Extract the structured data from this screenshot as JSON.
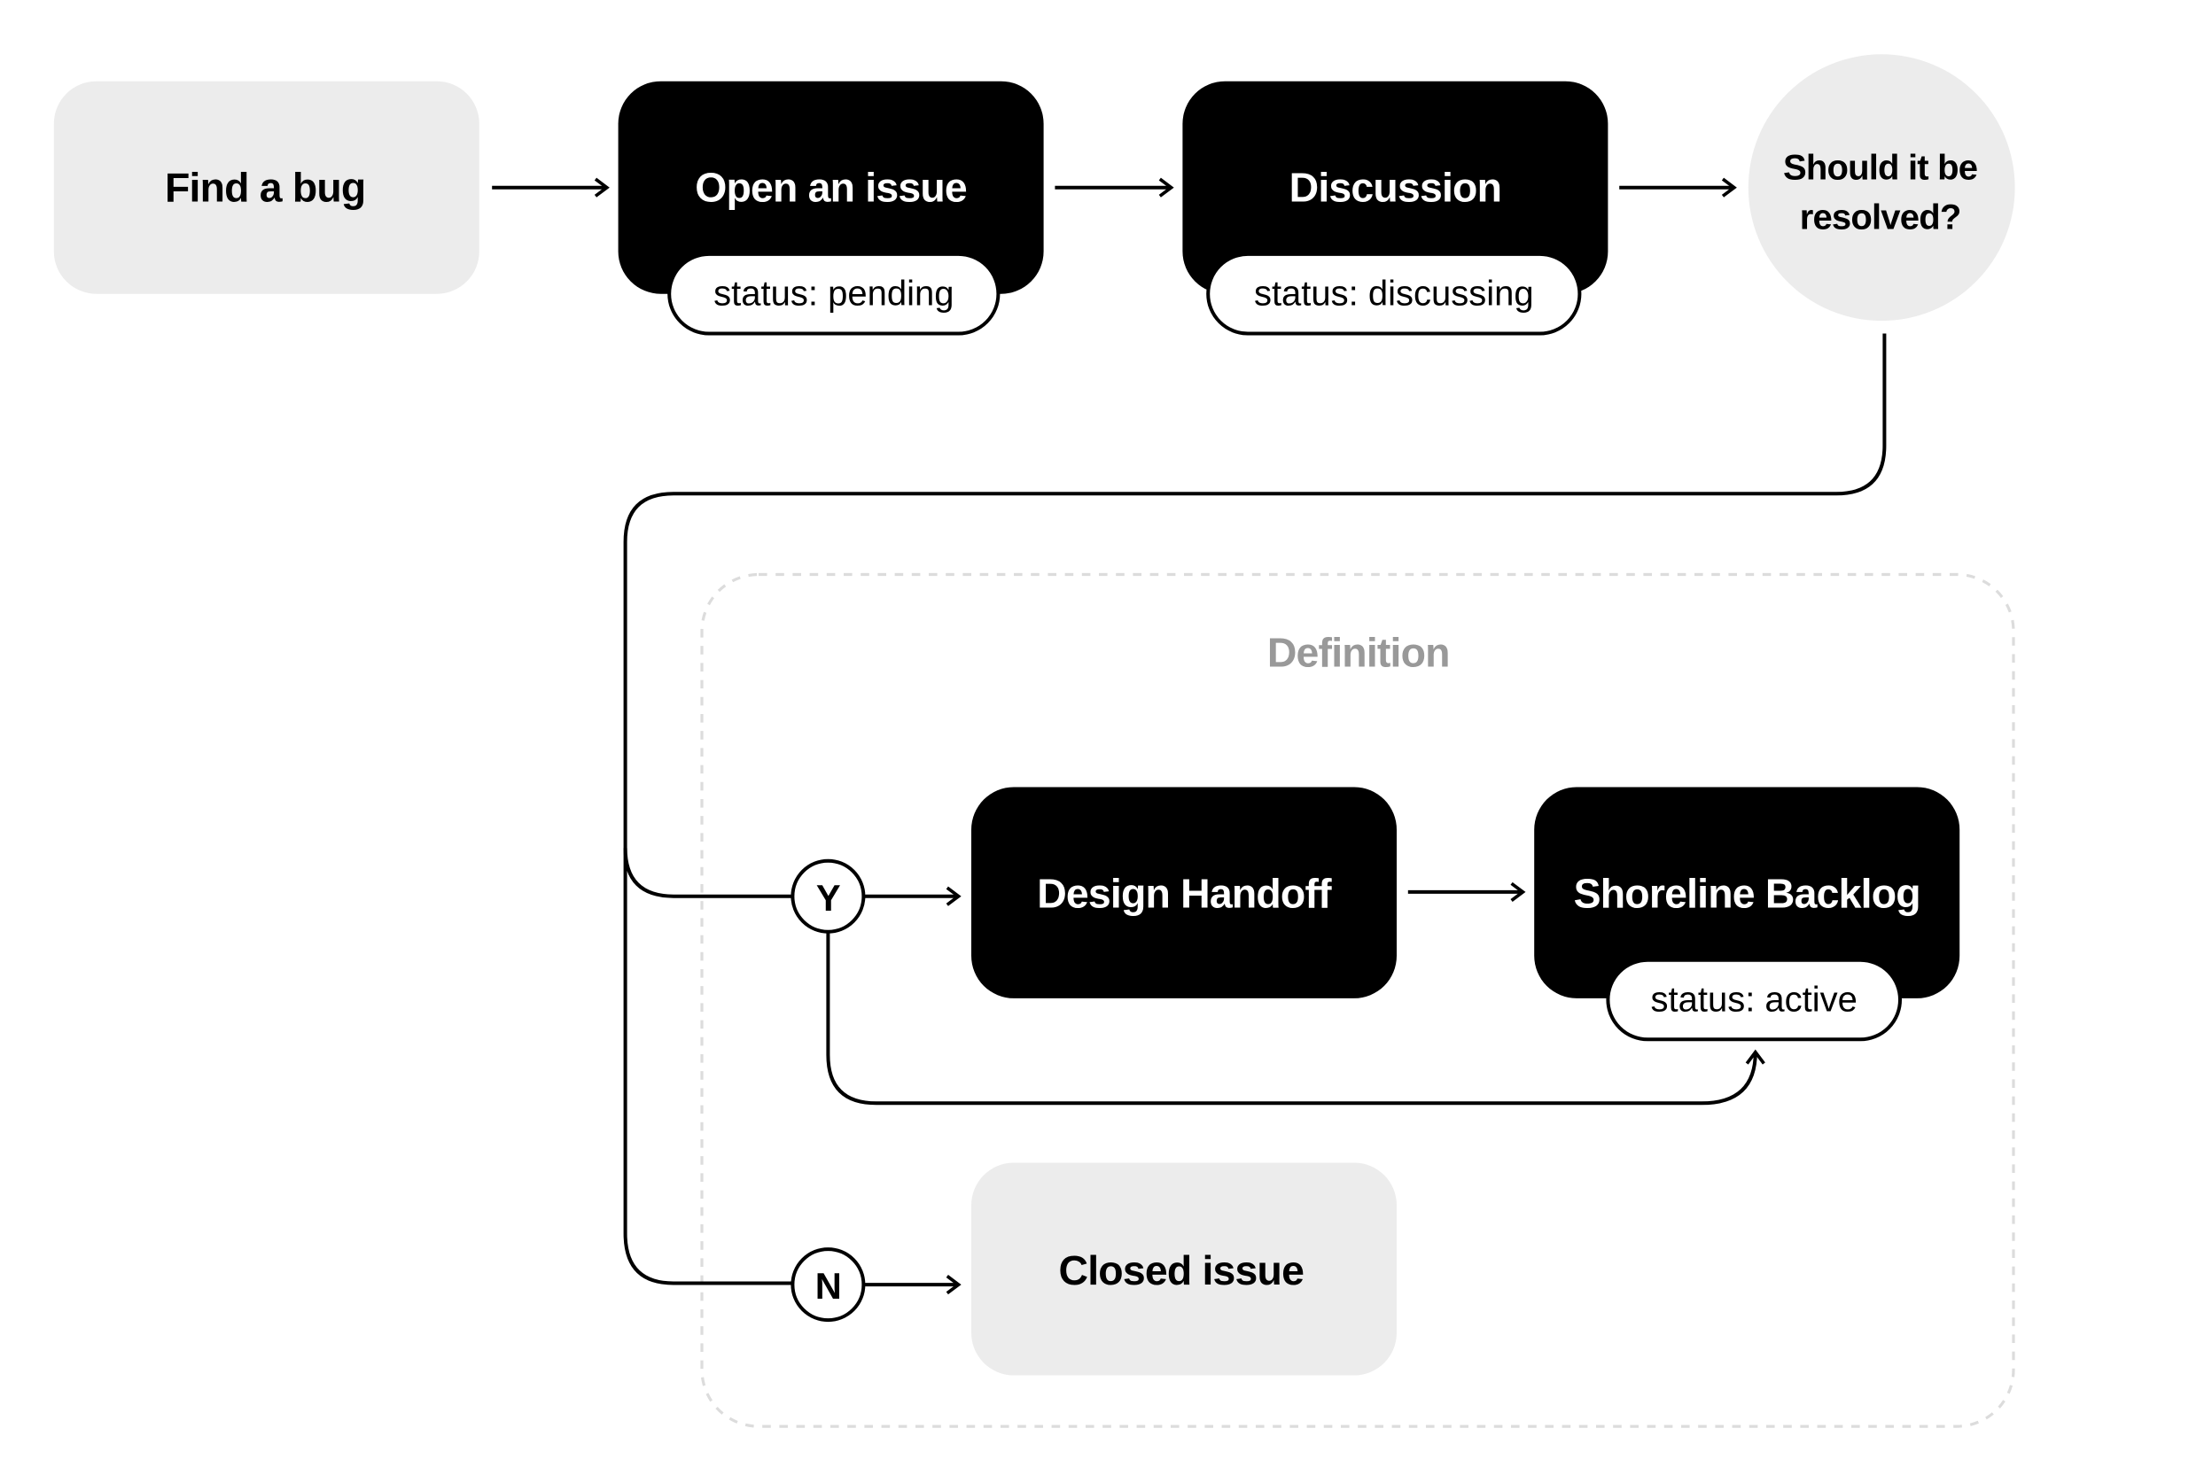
{
  "nodes": {
    "find_bug": {
      "label": "Find a bug"
    },
    "open_issue": {
      "label": "Open an issue",
      "status": "status: pending"
    },
    "discussion": {
      "label": "Discussion",
      "status": "status: discussing"
    },
    "decision": {
      "line1": "Should it be",
      "line2": "resolved?"
    },
    "design_handoff": {
      "label": "Design Handoff"
    },
    "shoreline_backlog": {
      "label": "Shoreline Backlog",
      "status": "status: active"
    },
    "closed_issue": {
      "label": "Closed issue"
    }
  },
  "group": {
    "label": "Definition"
  },
  "branches": {
    "yes": "Y",
    "no": "N"
  },
  "colors": {
    "dark_node": "#000000",
    "light_node": "#ececec",
    "group_border": "#dcdcdc",
    "group_label": "#999999"
  }
}
